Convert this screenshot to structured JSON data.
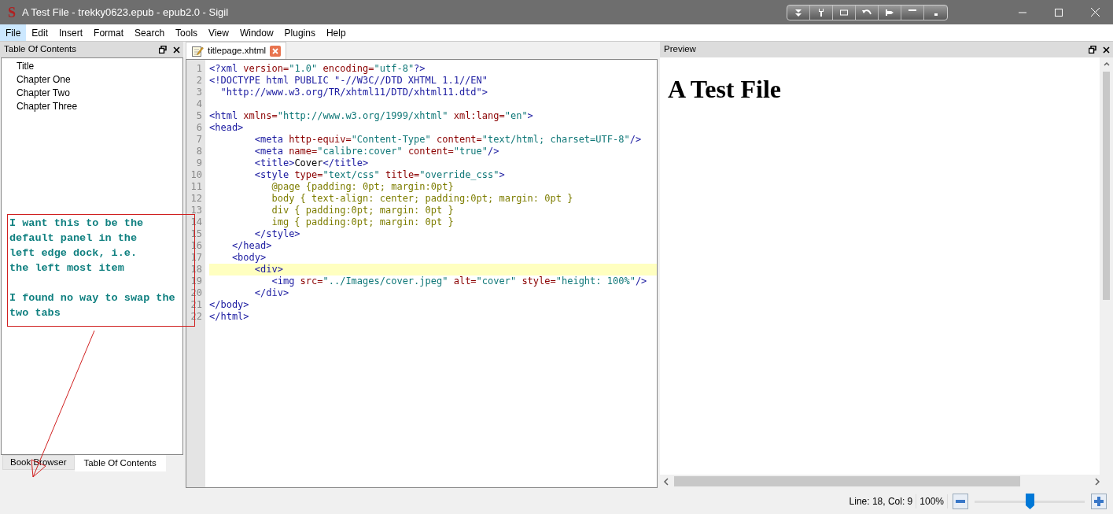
{
  "window": {
    "title": "A Test File - trekky0623.epub - epub2.0 - Sigil",
    "app_icon": "S"
  },
  "menu": [
    {
      "label": "File",
      "selected": true
    },
    {
      "label": "Edit",
      "selected": false
    },
    {
      "label": "Insert",
      "selected": false
    },
    {
      "label": "Format",
      "selected": false
    },
    {
      "label": "Search",
      "selected": false
    },
    {
      "label": "Tools",
      "selected": false
    },
    {
      "label": "View",
      "selected": false
    },
    {
      "label": "Window",
      "selected": false
    },
    {
      "label": "Plugins",
      "selected": false
    },
    {
      "label": "Help",
      "selected": false
    }
  ],
  "toc_panel": {
    "title": "Table Of Contents",
    "items": [
      "Title",
      "Chapter One",
      "Chapter Two",
      "Chapter Three"
    ]
  },
  "dock_tabs": [
    {
      "label": "Book Browser",
      "selected": false
    },
    {
      "label": "Table Of Contents",
      "selected": true
    }
  ],
  "editor": {
    "tab": "titlepage.xhtml",
    "lines": [
      {
        "number": "1",
        "highlighted": false,
        "tokens": [
          {
            "kind": "tag",
            "text": "<?xml"
          },
          {
            "kind": "attr",
            "text": " version="
          },
          {
            "kind": "value",
            "text": "\"1.0\""
          },
          {
            "kind": "attr",
            "text": " encoding="
          },
          {
            "kind": "value",
            "text": "\"utf-8\""
          },
          {
            "kind": "tag",
            "text": "?>"
          }
        ]
      },
      {
        "number": "2",
        "highlighted": false,
        "tokens": [
          {
            "kind": "tag",
            "text": "<!DOCTYPE html PUBLIC \"-//W3C//DTD XHTML 1.1//EN\""
          }
        ]
      },
      {
        "number": "3",
        "highlighted": false,
        "tokens": [
          {
            "kind": "tag",
            "text": "  \"http://www.w3.org/TR/xhtml11/DTD/xhtml11.dtd\">"
          }
        ]
      },
      {
        "number": "4",
        "highlighted": false
      },
      {
        "number": "5",
        "highlighted": false,
        "tokens": [
          {
            "kind": "tag",
            "text": "<html"
          },
          {
            "kind": "attr",
            "text": " xmlns="
          },
          {
            "kind": "value",
            "text": "\"http://www.w3.org/1999/xhtml\""
          },
          {
            "kind": "attr",
            "text": " xml:lang="
          },
          {
            "kind": "value",
            "text": "\"en\""
          },
          {
            "kind": "tag",
            "text": ">"
          }
        ]
      },
      {
        "number": "6",
        "highlighted": false,
        "tokens": [
          {
            "kind": "tag",
            "text": "<head>"
          }
        ]
      },
      {
        "number": "7",
        "highlighted": false,
        "tokens": [
          {
            "kind": "tag",
            "text": "        <meta"
          },
          {
            "kind": "attr",
            "text": " http-equiv="
          },
          {
            "kind": "value",
            "text": "\"Content-Type\""
          },
          {
            "kind": "attr",
            "text": " content="
          },
          {
            "kind": "value",
            "text": "\"text/html; charset=UTF-8\""
          },
          {
            "kind": "tag",
            "text": "/>"
          }
        ]
      },
      {
        "number": "8",
        "highlighted": false,
        "tokens": [
          {
            "kind": "tag",
            "text": "        <meta"
          },
          {
            "kind": "attr",
            "text": " name="
          },
          {
            "kind": "value",
            "text": "\"calibre:cover\""
          },
          {
            "kind": "attr",
            "text": " content="
          },
          {
            "kind": "value",
            "text": "\"true\""
          },
          {
            "kind": "tag",
            "text": "/>"
          }
        ]
      },
      {
        "number": "9",
        "highlighted": false,
        "tokens": [
          {
            "kind": "tag",
            "text": "        <title>"
          },
          {
            "kind": "text",
            "text": "Cover"
          },
          {
            "kind": "tag",
            "text": "</title>"
          }
        ]
      },
      {
        "number": "10",
        "highlighted": false,
        "tokens": [
          {
            "kind": "tag",
            "text": "        <style"
          },
          {
            "kind": "attr",
            "text": " type="
          },
          {
            "kind": "value",
            "text": "\"text/css\""
          },
          {
            "kind": "attr",
            "text": " title="
          },
          {
            "kind": "value",
            "text": "\"override_css\""
          },
          {
            "kind": "tag",
            "text": ">"
          }
        ]
      },
      {
        "number": "11",
        "highlighted": false,
        "tokens": [
          {
            "kind": "css",
            "text": "           @page {padding: 0pt; margin:0pt}"
          }
        ]
      },
      {
        "number": "12",
        "highlighted": false,
        "tokens": [
          {
            "kind": "css",
            "text": "           body { text-align: center; padding:0pt; margin: 0pt }"
          }
        ]
      },
      {
        "number": "13",
        "highlighted": false,
        "tokens": [
          {
            "kind": "css",
            "text": "           div { padding:0pt; margin: 0pt }"
          }
        ]
      },
      {
        "number": "14",
        "highlighted": false,
        "tokens": [
          {
            "kind": "css",
            "text": "           img { padding:0pt; margin: 0pt }"
          }
        ]
      },
      {
        "number": "15",
        "highlighted": false,
        "tokens": [
          {
            "kind": "tag",
            "text": "        </style>"
          }
        ]
      },
      {
        "number": "16",
        "highlighted": false,
        "tokens": [
          {
            "kind": "tag",
            "text": "    </head>"
          }
        ]
      },
      {
        "number": "17",
        "highlighted": false,
        "tokens": [
          {
            "kind": "tag",
            "text": "    <body>"
          }
        ]
      },
      {
        "number": "18",
        "highlighted": true,
        "tokens": [
          {
            "kind": "tag",
            "text": "        <div>"
          }
        ]
      },
      {
        "number": "19",
        "highlighted": false,
        "tokens": [
          {
            "kind": "tag",
            "text": "           <img"
          },
          {
            "kind": "attr",
            "text": " src="
          },
          {
            "kind": "value",
            "text": "\"../Images/cover.jpeg\""
          },
          {
            "kind": "attr",
            "text": " alt="
          },
          {
            "kind": "value",
            "text": "\"cover\""
          },
          {
            "kind": "attr",
            "text": " style="
          },
          {
            "kind": "value",
            "text": "\"height: 100%\""
          },
          {
            "kind": "tag",
            "text": "/>"
          }
        ]
      },
      {
        "number": "20",
        "highlighted": false,
        "tokens": [
          {
            "kind": "tag",
            "text": "        </div>"
          }
        ]
      },
      {
        "number": "21",
        "highlighted": false,
        "tokens": [
          {
            "kind": "tag",
            "text": "</body>"
          }
        ]
      },
      {
        "number": "22",
        "highlighted": false,
        "tokens": [
          {
            "kind": "tag",
            "text": "</html>"
          }
        ]
      }
    ]
  },
  "preview": {
    "title": "Preview",
    "heading": "A Test File"
  },
  "status_bar": {
    "position": "Line: 18, Col: 9",
    "zoom": "100%",
    "level": 0.5
  },
  "annotation": {
    "text": "I want this to be the\ndefault panel in the\nleft edge dock, i.e.\nthe left most item\n\nI found no way to swap the\ntwo tabs"
  }
}
